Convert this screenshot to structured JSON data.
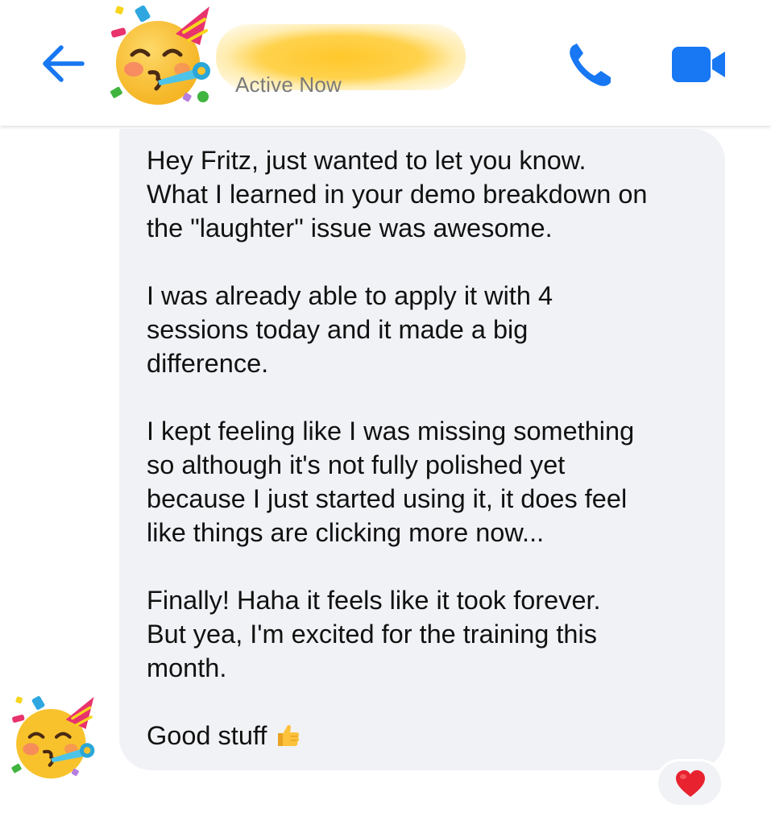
{
  "header": {
    "back_icon": "arrow-left-icon",
    "contact_avatar_icon": "partying-face-emoji",
    "status": "Active Now",
    "call_icon": "phone-icon",
    "video_icon": "video-camera-icon"
  },
  "message": {
    "text": "Hey Fritz, just wanted to let you know.\nWhat I learned in your demo breakdown on\nthe \"laughter\" issue was awesome.\n\nI was already able to apply it with 4\nsessions today and it made a big\ndifference.\n\nI kept feeling like I was missing something\nso although it's not fully polished yet\nbecause I just started using it, it does feel\nlike things are clicking more now...\n\nFinally! Haha it feels like it took forever.\nBut yea, I'm excited for the training this\nmonth.\n\nGood stuff",
    "trailing_emoji": "thumbs-up-emoji",
    "sender_avatar_icon": "partying-face-emoji",
    "reaction": "red-heart-emoji"
  },
  "colors": {
    "accent_blue": "#1877f2",
    "bubble_bg": "#f1f2f6",
    "status_gray": "#7a7a7a",
    "redaction_yellow": "#ffc72a",
    "heart_red": "#e8232f"
  }
}
